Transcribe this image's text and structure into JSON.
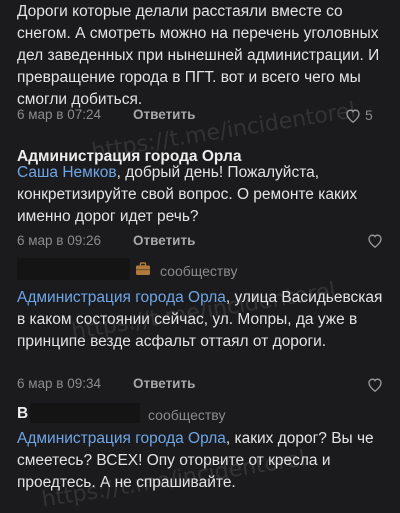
{
  "watermark": "https://t.me/incidentorel",
  "comments": [
    {
      "text": "Дороги которые делали расстаяли вместе со снегом. А смотреть можно на перечень уголовных дел заведенных при нынешней администрации. И превращение города в ПГТ. вот и всего чего мы смогли добиться.",
      "date": "6 мар в 07:24",
      "reply_label": "Ответить",
      "likes": "5"
    },
    {
      "author": "Администрация города Орла",
      "mention": "Саша Немков",
      "text": ", добрый день! Пожалуйста, конкретизируйте свой вопрос. О ремонте каких именно дорог идет речь?",
      "date": "6 мар в 09:26",
      "reply_label": "Ответить"
    },
    {
      "author_suffix": "сообществу",
      "mention": "Администрация города Орла",
      "text": ",  улица Васидьевская в каком состоянии сейчас, ул. Мопры, да уже в принципе везде асфальт оттаял от дороги.",
      "date": "6 мар в 09:34",
      "reply_label": "Ответить"
    },
    {
      "author_initial": "В",
      "author_suffix": "сообществу",
      "mention": "Администрация города Орла",
      "text": ", каких дорог? Вы че смеетесь? ВСЕХ! Опу оторвите от кресла и проедтесь. А не спрашивайте."
    }
  ]
}
